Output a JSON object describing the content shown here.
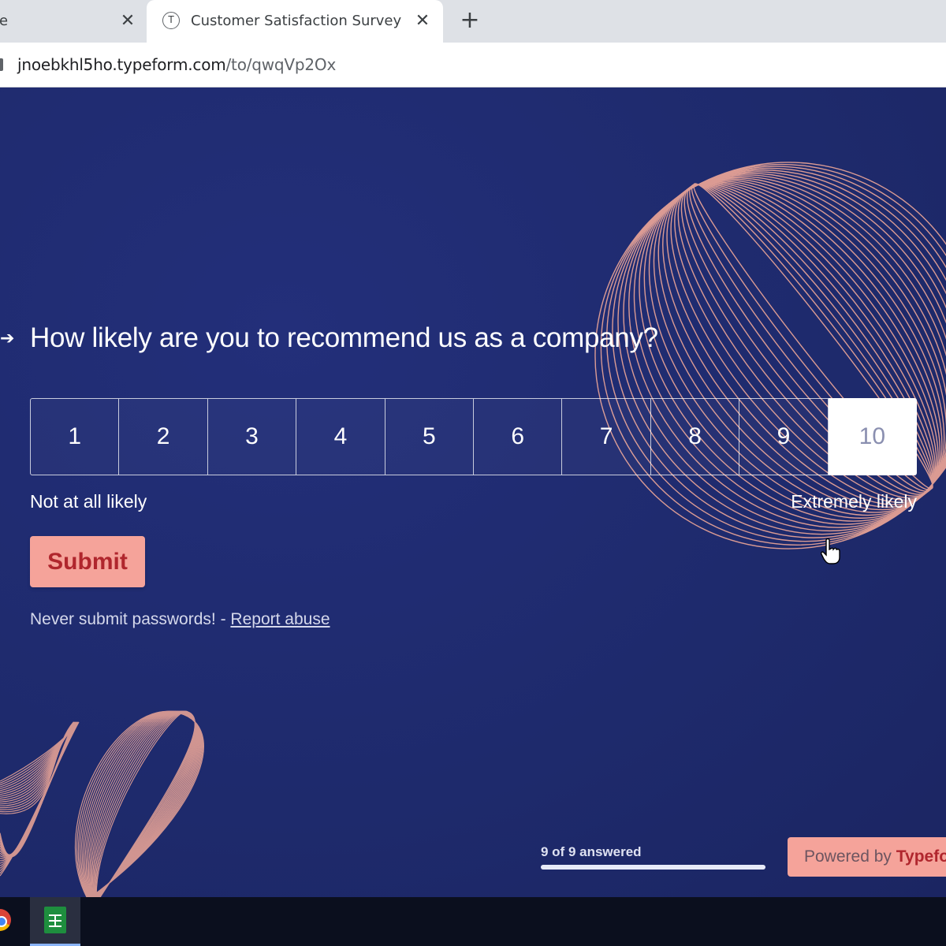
{
  "browser": {
    "tabs": [
      {
        "title": "te",
        "close_icon": "✕"
      },
      {
        "title": "Customer Satisfaction Survey",
        "favicon_letter": "T",
        "close_icon": "✕"
      }
    ],
    "new_tab_icon": "+",
    "url_host": "jnoebkhl5ho.typeform.com",
    "url_path": "/to/qwqVp2Ox"
  },
  "survey": {
    "arrow": "➔",
    "question": "How likely are you to recommend us as a company?",
    "scale": [
      "1",
      "2",
      "3",
      "4",
      "5",
      "6",
      "7",
      "8",
      "9",
      "10"
    ],
    "selected": "10",
    "label_low": "Not at all likely",
    "label_high": "Extremely likely",
    "submit_label": "Submit",
    "notice_text": "Never submit passwords! - ",
    "report_link": "Report abuse"
  },
  "footer": {
    "progress_text": "9 of 9 answered",
    "progress_fraction": 1.0,
    "powered_by": "Powered by",
    "brand": "Typefo"
  },
  "colors": {
    "page_bg": "#1f2a6e",
    "accent": "#f5a39a",
    "accent_text": "#b0262d",
    "deco_line": "#f0a898"
  },
  "taskbar": {
    "icons": [
      "chrome-icon",
      "google-sheets-icon"
    ]
  }
}
